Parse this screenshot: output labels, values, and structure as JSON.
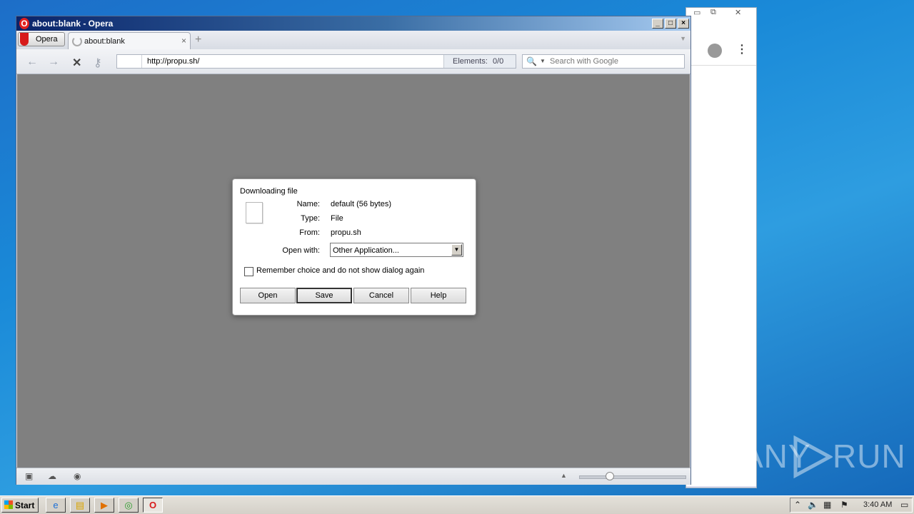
{
  "window": {
    "title": "about:blank - Opera",
    "menu_label": "Opera",
    "tab_label": "about:blank",
    "close_glyph": "×",
    "new_tab_glyph": "+"
  },
  "navbar": {
    "back_glyph": "←",
    "forward_glyph": "→",
    "stop_glyph": "✕",
    "key_glyph": "⚷",
    "url": "http://propu.sh/",
    "elements_label": "Elements:",
    "elements_value": "0/0",
    "search_placeholder": "Search with Google"
  },
  "dialog": {
    "title": "Downloading file",
    "name_label": "Name:",
    "name_value": "default (56 bytes)",
    "type_label": "Type:",
    "type_value": "File",
    "from_label": "From:",
    "from_value": "propu.sh",
    "open_with_label": "Open with:",
    "open_with_value": "Other Application...",
    "remember_label": "Remember choice and do not show dialog again",
    "remember_checked": false,
    "buttons": {
      "open": "Open",
      "save": "Save",
      "cancel": "Cancel",
      "help": "Help"
    }
  },
  "taskbar": {
    "start_label": "Start",
    "clock": "3:40 AM",
    "apps": [
      "ie-icon",
      "explorer-icon",
      "media-player-icon",
      "chrome-icon",
      "opera-icon"
    ]
  },
  "watermark": {
    "left": "ANY",
    "right": "RUN"
  },
  "colors": {
    "desktop": "#1a8ad8",
    "content_bg": "#808080",
    "opera_red": "#d71b1b"
  }
}
